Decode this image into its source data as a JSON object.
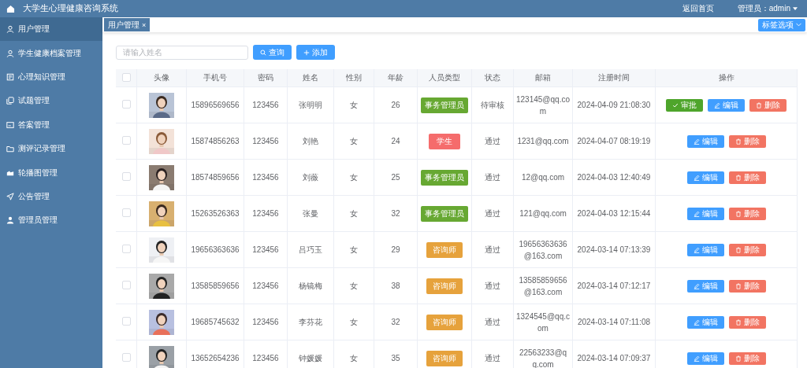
{
  "header": {
    "title": "大学生心理健康咨询系统",
    "home_link": "返回首页",
    "user_menu": "管理员：admin"
  },
  "sidebar": {
    "items": [
      {
        "label": "用户管理",
        "selected": true
      },
      {
        "label": "学生健康档案管理",
        "selected": false
      },
      {
        "label": "心理知识管理",
        "selected": false
      },
      {
        "label": "试题管理",
        "selected": false
      },
      {
        "label": "答案管理",
        "selected": false
      },
      {
        "label": "测评记录管理",
        "selected": false
      },
      {
        "label": "轮播图管理",
        "selected": false
      },
      {
        "label": "公告管理",
        "selected": false
      },
      {
        "label": "管理员管理",
        "selected": false
      }
    ]
  },
  "tabs": [
    {
      "label": "用户管理",
      "close": "×",
      "selected": true
    }
  ],
  "tab_options": "标签选项",
  "search": {
    "placeholder": "请输入姓名",
    "query_button": "查询",
    "add_button": "添加"
  },
  "table": {
    "select_all": {
      "checked": false
    },
    "columns": [
      "头像",
      "手机号",
      "密码",
      "姓名",
      "性别",
      "年龄",
      "人员类型",
      "状态",
      "邮箱",
      "注册时间",
      "操作"
    ],
    "rows": [
      {
        "checked": false,
        "phone": "15896569656",
        "password": "123456",
        "name": "张明明",
        "gender": "女",
        "age": "26",
        "type": {
          "label": "事务管理员",
          "kind": "admin"
        },
        "status": "待审核",
        "email": "123145@qq.com",
        "registered": "2024-04-09 21:08:30",
        "actions": [
          {
            "label": "审批",
            "kind": "approve"
          },
          {
            "label": "编辑",
            "kind": "edit"
          },
          {
            "label": "删除",
            "kind": "delete"
          }
        ]
      },
      {
        "checked": false,
        "phone": "15874856263",
        "password": "123456",
        "name": "刘艳",
        "gender": "女",
        "age": "24",
        "type": {
          "label": "学生",
          "kind": "student"
        },
        "status": "通过",
        "email": "1231@qq.com",
        "registered": "2024-04-07 08:19:19",
        "actions": [
          {
            "label": "编辑",
            "kind": "edit"
          },
          {
            "label": "删除",
            "kind": "delete"
          }
        ]
      },
      {
        "checked": false,
        "phone": "18574859656",
        "password": "123456",
        "name": "刘薇",
        "gender": "女",
        "age": "25",
        "type": {
          "label": "事务管理员",
          "kind": "admin"
        },
        "status": "通过",
        "email": "12@qq.com",
        "registered": "2024-04-03 12:40:49",
        "actions": [
          {
            "label": "编辑",
            "kind": "edit"
          },
          {
            "label": "删除",
            "kind": "delete"
          }
        ]
      },
      {
        "checked": false,
        "phone": "15263526363",
        "password": "123456",
        "name": "张曼",
        "gender": "女",
        "age": "32",
        "type": {
          "label": "事务管理员",
          "kind": "admin"
        },
        "status": "通过",
        "email": "121@qq.com",
        "registered": "2024-04-03 12:15:44",
        "actions": [
          {
            "label": "编辑",
            "kind": "edit"
          },
          {
            "label": "删除",
            "kind": "delete"
          }
        ]
      },
      {
        "checked": false,
        "phone": "19656363636",
        "password": "123456",
        "name": "吕巧玉",
        "gender": "女",
        "age": "29",
        "type": {
          "label": "咨询师",
          "kind": "counselor"
        },
        "status": "通过",
        "email": "19656363636@163.com",
        "registered": "2024-03-14 07:13:39",
        "actions": [
          {
            "label": "编辑",
            "kind": "edit"
          },
          {
            "label": "删除",
            "kind": "delete"
          }
        ]
      },
      {
        "checked": false,
        "phone": "13585859656",
        "password": "123456",
        "name": "杨镜梅",
        "gender": "女",
        "age": "38",
        "type": {
          "label": "咨询师",
          "kind": "counselor"
        },
        "status": "通过",
        "email": "13585859656@163.com",
        "registered": "2024-03-14 07:12:17",
        "actions": [
          {
            "label": "编辑",
            "kind": "edit"
          },
          {
            "label": "删除",
            "kind": "delete"
          }
        ]
      },
      {
        "checked": false,
        "phone": "19685745632",
        "password": "123456",
        "name": "李芬花",
        "gender": "女",
        "age": "32",
        "type": {
          "label": "咨询师",
          "kind": "counselor"
        },
        "status": "通过",
        "email": "1324545@qq.com",
        "registered": "2024-03-14 07:11:08",
        "actions": [
          {
            "label": "编辑",
            "kind": "edit"
          },
          {
            "label": "删除",
            "kind": "delete"
          }
        ]
      },
      {
        "checked": false,
        "phone": "13652654236",
        "password": "123456",
        "name": "钟媛媛",
        "gender": "女",
        "age": "35",
        "type": {
          "label": "咨询师",
          "kind": "counselor"
        },
        "status": "通过",
        "email": "22563233@qq.com",
        "registered": "2024-03-14 07:09:37",
        "actions": [
          {
            "label": "编辑",
            "kind": "edit"
          },
          {
            "label": "删除",
            "kind": "delete"
          }
        ]
      }
    ]
  }
}
